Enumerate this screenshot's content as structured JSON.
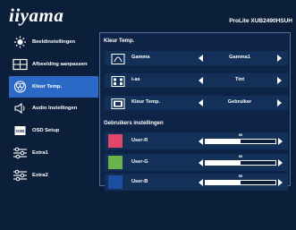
{
  "brand": "iiyama",
  "model": "ProLite XUB2490HSUH",
  "sidebar": {
    "items": [
      {
        "label": "Beeldinstellingen",
        "icon": "brightness-icon",
        "active": false
      },
      {
        "label": "Afbeelding aanpassen",
        "icon": "image-adjust-icon",
        "active": false
      },
      {
        "label": "Kleur Temp.",
        "icon": "color-temp-icon",
        "active": true
      },
      {
        "label": "Audio Instellingen",
        "icon": "speaker-icon",
        "active": false
      },
      {
        "label": "OSD Setup",
        "icon": "osd-icon",
        "active": false
      },
      {
        "label": "Extra1",
        "icon": "sliders-icon",
        "active": false
      },
      {
        "label": "Extra2",
        "icon": "sliders-icon",
        "active": false
      }
    ]
  },
  "panel": {
    "title": "Kleur Temp.",
    "rows": [
      {
        "label": "Gamma",
        "value": "Gamma1",
        "icon": "gamma-icon"
      },
      {
        "label": "i-as",
        "value": "Tint",
        "icon": "grid-icon"
      },
      {
        "label": "Kleur Temp.",
        "value": "Gebruiker",
        "icon": "color-temp-icon"
      }
    ],
    "section_title": "Gebruikers instellingen",
    "user": [
      {
        "label": "User-R",
        "value": "50",
        "level": 0.5,
        "color": "#e5466b"
      },
      {
        "label": "User-G",
        "value": "50",
        "level": 0.5,
        "color": "#6ab24a"
      },
      {
        "label": "User-B",
        "value": "50",
        "level": 0.5,
        "color": "#1d4ea2"
      }
    ]
  },
  "colors": {
    "background": "#0c1f3a",
    "accent": "#2a6ac6",
    "panel_border": "#4d6f9c"
  }
}
